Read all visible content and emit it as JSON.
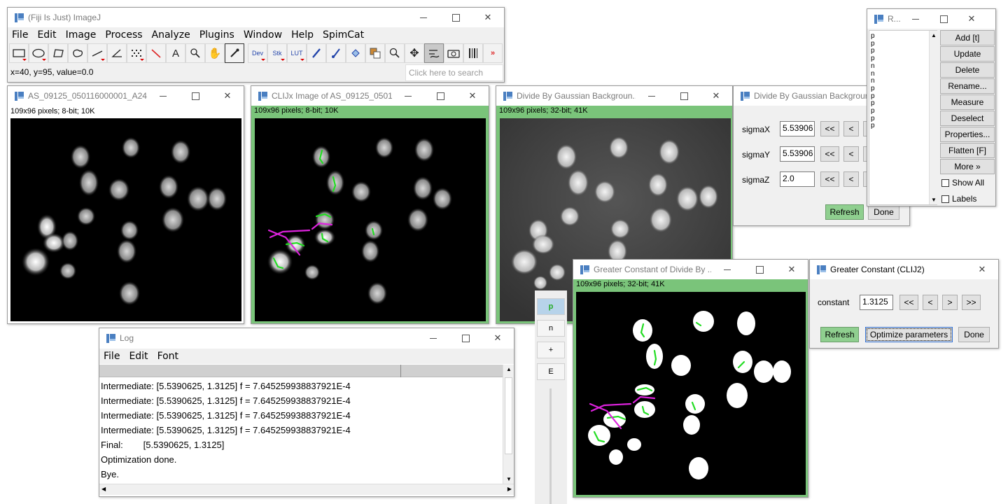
{
  "fiji": {
    "title": "(Fiji Is Just) ImageJ",
    "menu": [
      "File",
      "Edit",
      "Image",
      "Process",
      "Analyze",
      "Plugins",
      "Window",
      "Help",
      "SpimCat"
    ],
    "tools": [
      "rect-tool",
      "oval-tool",
      "polygon-tool",
      "freehand-tool",
      "line-tool",
      "angle-tool",
      "point-tool",
      "wand-tool",
      "text-tool",
      "zoom-tool",
      "hand-tool",
      "color-picker-tool"
    ],
    "tools2": {
      "dev": "Dev",
      "stk": "Stk",
      "lut": "LUT"
    },
    "more_tools": "»",
    "status": "x=40, y=95, value=0.0",
    "search_placeholder": "Click here to search"
  },
  "img1": {
    "title": "AS_09125_050116000001_A24f...",
    "info": "109x96 pixels; 8-bit; 10K"
  },
  "img2": {
    "title": "CLIJx Image of AS_09125_0501...",
    "info": "109x96 pixels; 8-bit; 10K"
  },
  "img3": {
    "title": "Divide By Gaussian Backgroun...",
    "info": "109x96 pixels; 32-bit; 41K"
  },
  "img4": {
    "title": "Greater Constant of Divide By ...",
    "info": "109x96 pixels; 32-bit; 41K"
  },
  "dgb": {
    "title": "Divide By Gaussian Backgroun",
    "rows": [
      {
        "label": "sigmaX",
        "value": "5.53906"
      },
      {
        "label": "sigmaY",
        "value": "5.53906"
      },
      {
        "label": "sigmaZ",
        "value": "2.0"
      }
    ],
    "nav": [
      "<<",
      "<"
    ],
    "refresh": "Refresh",
    "done": "Done"
  },
  "gc": {
    "title": "Greater Constant (CLIJ2)",
    "label": "constant",
    "value": "1.3125",
    "nav": [
      "<<",
      "<",
      ">",
      ">>"
    ],
    "refresh": "Refresh",
    "optimize": "Optimize parameters",
    "done": "Done"
  },
  "roi": {
    "title": "R...",
    "items": [
      "p",
      "p",
      "p",
      "p",
      "n",
      "n",
      "n",
      "p",
      "p",
      "p",
      "p",
      "p",
      "p"
    ],
    "buttons": [
      "Add [t]",
      "Update",
      "Delete",
      "Rename...",
      "Measure",
      "Deselect",
      "Properties...",
      "Flatten [F]",
      "More »"
    ],
    "show_all": "Show All",
    "labels": "Labels"
  },
  "log": {
    "title": "Log",
    "menu": [
      "File",
      "Edit",
      "Font"
    ],
    "lines": [
      "Intermediate: [5.5390625, 1.3125] f = 7.645259938837921E-4",
      "Intermediate: [5.5390625, 1.3125] f = 7.645259938837921E-4",
      "Intermediate: [5.5390625, 1.3125] f = 7.645259938837921E-4",
      "Intermediate: [5.5390625, 1.3125] f = 7.645259938837921E-4",
      "Final:        [5.5390625, 1.3125]",
      "Optimization done.",
      "Bye."
    ]
  },
  "side": {
    "buttons": [
      "p",
      "n",
      "+",
      "E"
    ],
    "accent": "#7ac47a"
  }
}
